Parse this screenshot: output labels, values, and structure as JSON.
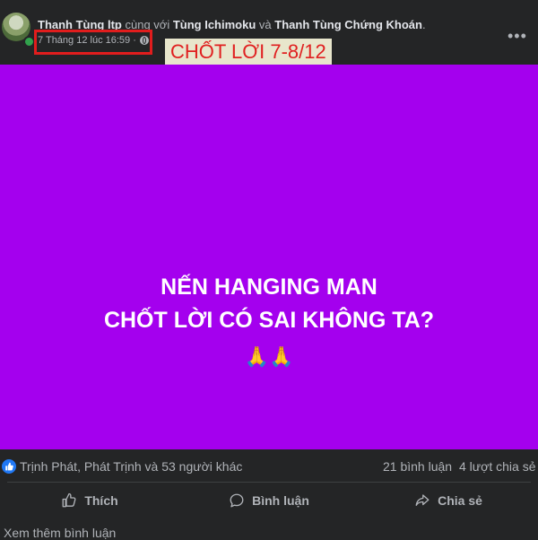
{
  "post": {
    "author": "Thanh Tùng ltp",
    "with_text": "cùng với",
    "tag1": "Tùng Ichimoku",
    "and_text": "và",
    "tag2": "Thanh Tùng Chứng Khoán",
    "trailing": ".",
    "timestamp": "7 Tháng 12 lúc 16:59 ·",
    "overlay_label": "CHỐT LỜI 7-8/12",
    "image_text_line1": "NẾN HANGING MAN",
    "image_text_line2": "CHỐT LỜI CÓ SAI KHÔNG TA?",
    "image_emoji": "🙏🙏",
    "image_bg_color": "#a400ee",
    "more_options": "•••"
  },
  "stats": {
    "reactions": "Trịnh Phát, Phát Trịnh và 53 người khác",
    "comments": "21 bình luận",
    "shares": "4 lượt chia sẻ"
  },
  "actions": {
    "like": "Thích",
    "comment": "Bình luận",
    "share": "Chia sẻ"
  },
  "footer": {
    "more_comments": "Xem thêm bình luận"
  },
  "icons": {
    "globe": "globe-icon",
    "like_reaction": "like-reaction-icon",
    "like": "thumbs-up-icon",
    "comment": "comment-bubble-icon",
    "share": "share-arrow-icon",
    "more": "more-options-icon"
  }
}
